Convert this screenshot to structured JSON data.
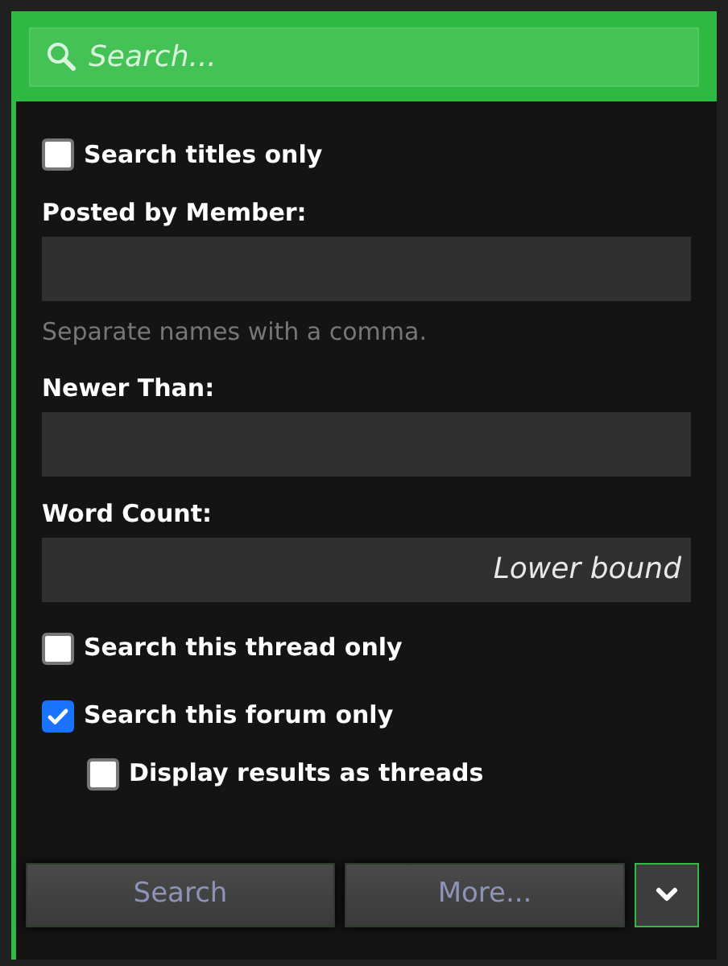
{
  "search": {
    "placeholder": "Search..."
  },
  "options": [
    {
      "kind": "checkbox",
      "label": "Search titles only",
      "checked": false
    },
    {
      "kind": "field",
      "label": "Posted by Member:",
      "hint": "Separate names with a comma."
    },
    {
      "kind": "field",
      "label": "Newer Than:"
    },
    {
      "kind": "field",
      "label": "Word Count:",
      "placeholder": "Lower bound"
    },
    {
      "kind": "checkbox",
      "label": "Search this thread only",
      "checked": false
    },
    {
      "kind": "checkbox",
      "label": "Search this forum only",
      "checked": true,
      "children": [
        {
          "kind": "checkbox",
          "label": "Display results as threads",
          "checked": false
        }
      ]
    }
  ],
  "buttons": [
    {
      "kind": "text",
      "label": "Search"
    },
    {
      "kind": "text",
      "label": "More..."
    },
    {
      "kind": "menu"
    }
  ]
}
